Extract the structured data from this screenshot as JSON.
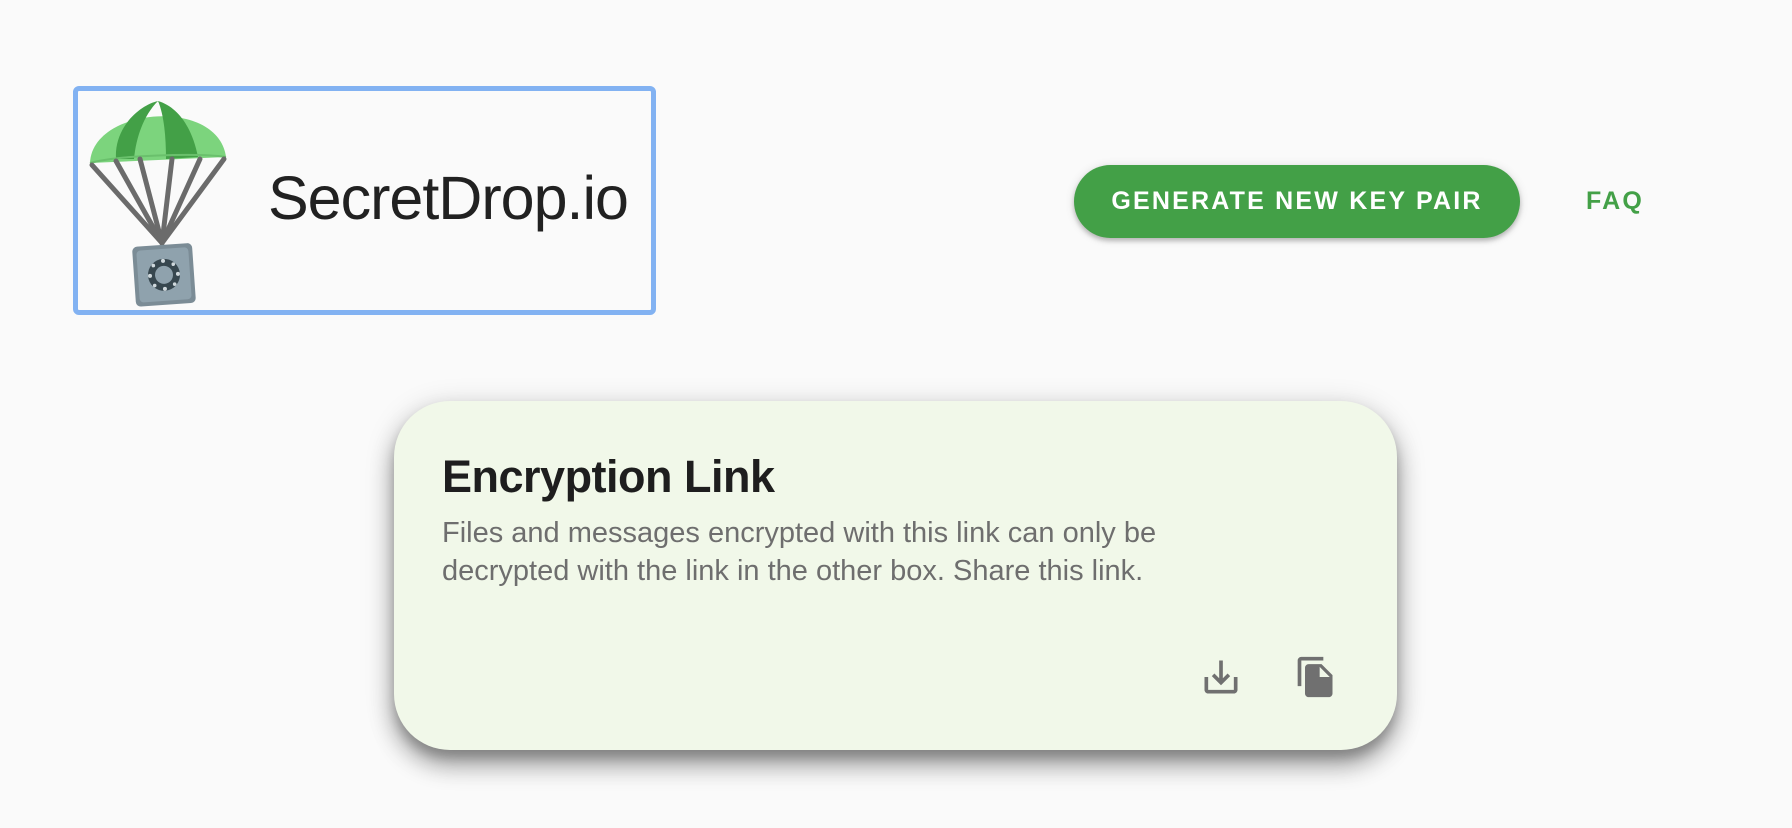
{
  "header": {
    "logo_text": "SecretDrop.io",
    "generate_label": "GENERATE NEW KEY PAIR",
    "faq_label": "FAQ"
  },
  "card": {
    "title": "Encryption Link",
    "description": "Files and messages encrypted with this link can only be decrypted with the link in the other box. Share this link.",
    "actions": [
      {
        "name": "download",
        "icon": "download-icon"
      },
      {
        "name": "copy",
        "icon": "copy-icon"
      }
    ]
  },
  "colors": {
    "background": "#fafafa",
    "primary": "#43a047",
    "card_background": "#f1f8e9",
    "focus_outline": "#82b2f2",
    "text_primary": "#212121",
    "text_secondary": "#6e6e6e",
    "icon": "#707070"
  }
}
